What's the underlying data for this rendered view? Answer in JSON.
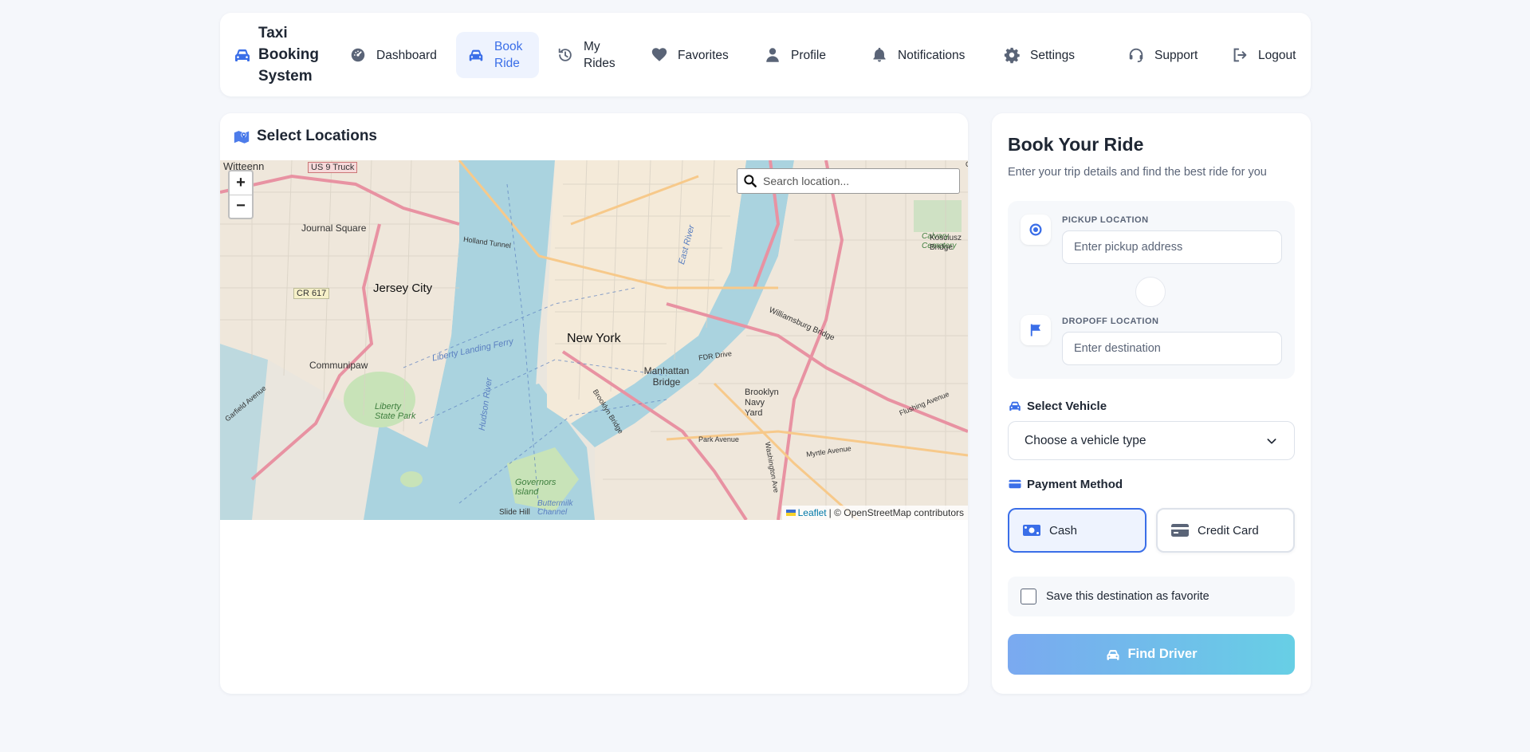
{
  "brand": {
    "title": "Taxi Booking System"
  },
  "nav": {
    "dashboard": "Dashboard",
    "book_ride": "Book Ride",
    "my_rides": "My Rides",
    "favorites": "Favorites",
    "profile": "Profile",
    "notifications": "Notifications",
    "settings": "Settings",
    "support": "Support",
    "logout": "Logout"
  },
  "map_section": {
    "title": "Select Locations",
    "search_placeholder": "Search location...",
    "zoom_in": "+",
    "zoom_out": "−",
    "attribution_link": "Leaflet",
    "attribution_text": "| © OpenStreetMap contributors",
    "labels": {
      "new_york": "New York",
      "jersey_city": "Jersey City",
      "journal_square": "Journal Square",
      "communipaw": "Communipaw",
      "manhattan_bridge": "Manhattan Bridge",
      "williamsburg_bridge": "Williamsburg Bridge",
      "brooklyn_navy_yard": "Brooklyn Navy Yard",
      "governors_island": "Governors Island",
      "liberty_state_park": "Liberty State Park",
      "calvary_cemetery": "Calvary Cemetery",
      "us9_truck": "US 9 Truck",
      "cr617": "CR 617",
      "slide_hill": "Slide Hill",
      "hudson_river": "Hudson River",
      "east_river": "East River",
      "liberty_landing": "Liberty Landing Ferry",
      "kosciuszko": "Kosciusz Bridge",
      "fdr_drive": "FDR Drive",
      "myrtle_avenue": "Myrtle Avenue",
      "park_avenue": "Park Avenue",
      "flushing_avenue": "Flushing Avenue",
      "holland_tunnel": "Holland Tunnel",
      "brooklyn_bridge": "Brooklyn Bridge",
      "washington_ave": "Washington Ave",
      "garfield_avenue": "Garfield Avenue",
      "witteenn": "Witteenn",
      "buttermilk": "Buttermilk Channel"
    }
  },
  "booking": {
    "title": "Book Your Ride",
    "subtitle": "Enter your trip details and find the best ride for you",
    "pickup_label": "PICKUP LOCATION",
    "pickup_placeholder": "Enter pickup address",
    "dropoff_label": "DROPOFF LOCATION",
    "dropoff_placeholder": "Enter destination",
    "vehicle_label": "Select Vehicle",
    "vehicle_selected": "Choose a vehicle type",
    "payment_label": "Payment Method",
    "payment_cash": "Cash",
    "payment_card": "Credit Card",
    "save_favorite": "Save this destination as favorite",
    "find_driver": "Find Driver"
  },
  "colors": {
    "accent": "#3a6ee8",
    "active_bg": "#eef3fe",
    "find_gradient_start": "#7aa9f0",
    "find_gradient_end": "#67cfe5"
  }
}
